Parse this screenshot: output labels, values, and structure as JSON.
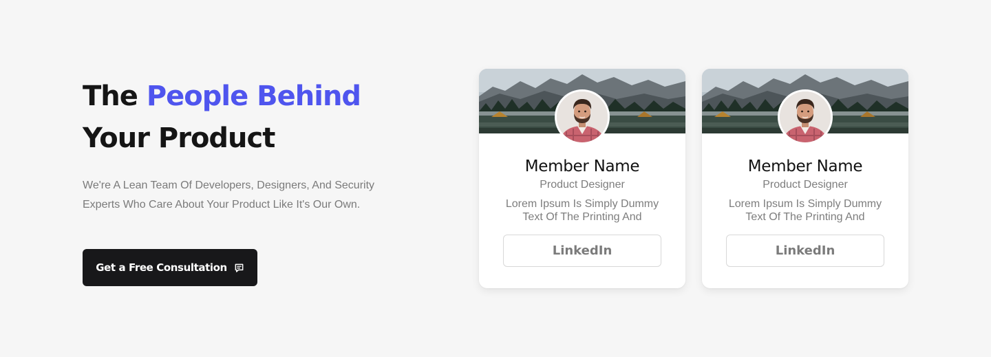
{
  "hero": {
    "headline_part1": "The ",
    "headline_accent": "People Behind",
    "headline_part2": " Your Product",
    "subtitle": "We're A Lean Team Of Developers, Designers, And Security Experts Who Care About Your Product Like It's Our Own.",
    "cta_label": "Get a Free Consultation",
    "cta_icon": "chat-bubble-icon"
  },
  "team": {
    "members": [
      {
        "name": "Member Name",
        "role": "Product Designer",
        "bio": "Lorem Ipsum Is Simply Dummy Text Of The Printing And",
        "link_label": "LinkedIn"
      },
      {
        "name": "Member Name",
        "role": "Product Designer",
        "bio": "Lorem Ipsum Is Simply Dummy Text Of The Printing And",
        "link_label": "LinkedIn"
      }
    ]
  },
  "colors": {
    "accent": "#4f55ee",
    "heading": "#151515",
    "body_text": "#7a7a7a",
    "button_bg": "#18181a",
    "page_bg": "#f6f6f6"
  }
}
